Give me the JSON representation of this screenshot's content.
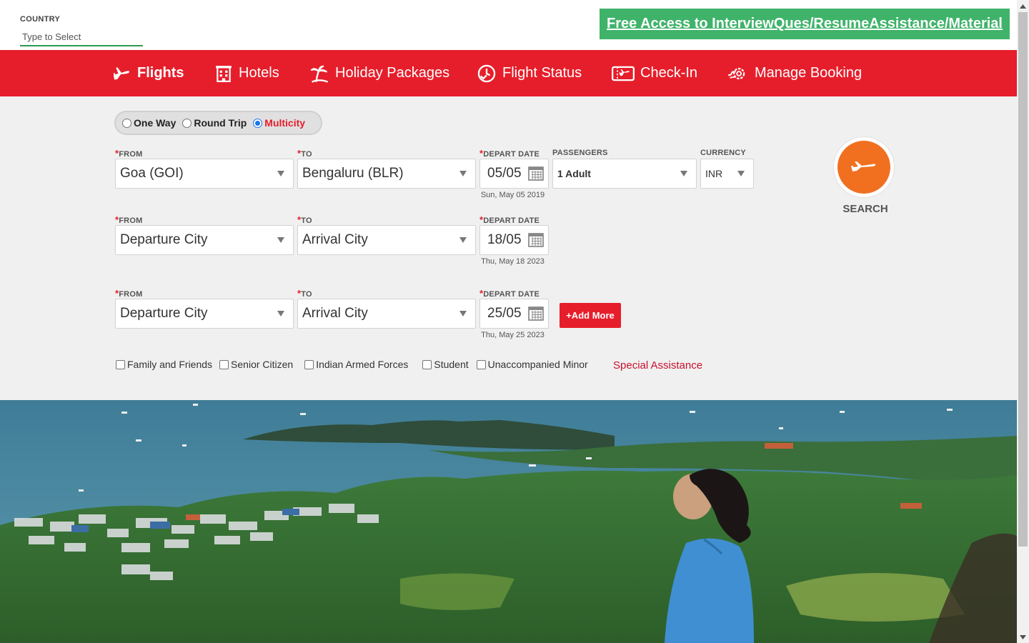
{
  "top": {
    "country_label": "COUNTRY",
    "country_placeholder": "Type to Select",
    "promo_link": "Free Access to InterviewQues/ResumeAssistance/Material"
  },
  "nav": {
    "items": [
      {
        "label": "Flights",
        "icon": "plane-icon",
        "active": true
      },
      {
        "label": "Hotels",
        "icon": "hotel-building-icon",
        "active": false
      },
      {
        "label": "Holiday Packages",
        "icon": "palm-tree-icon",
        "active": false
      },
      {
        "label": "Flight Status",
        "icon": "clock-check-icon",
        "active": false
      },
      {
        "label": "Check-In",
        "icon": "ticket-plane-icon",
        "active": false
      },
      {
        "label": "Manage Booking",
        "icon": "gear-plane-icon",
        "active": false
      }
    ]
  },
  "trip_type": {
    "options": [
      "One Way",
      "Round Trip",
      "Multicity"
    ],
    "selected": "Multicity"
  },
  "labels": {
    "from": "FROM",
    "to": "TO",
    "depart_date": "DEPART DATE",
    "passengers": "PASSENGERS",
    "currency": "CURRENCY",
    "required_mark": "*"
  },
  "legs": [
    {
      "from": "Goa (GOI)",
      "to": "Bengaluru (BLR)",
      "date": "05/05",
      "date_full": "Sun, May 05 2019"
    },
    {
      "from": "Departure City",
      "to": "Arrival City",
      "date": "18/05",
      "date_full": "Thu, May 18 2023"
    },
    {
      "from": "Departure City",
      "to": "Arrival City",
      "date": "25/05",
      "date_full": "Thu, May 25 2023"
    }
  ],
  "passengers": "1 Adult",
  "currency": "INR",
  "add_more": "+Add More",
  "search": "SEARCH",
  "special_fares": [
    "Family and Friends",
    "Senior Citizen",
    "Indian Armed Forces",
    "Student",
    "Unaccompanied Minor"
  ],
  "special_assistance": "Special Assistance",
  "colors": {
    "brand_red": "#e61e2b",
    "promo_green": "#40b36b",
    "search_orange": "#f07020"
  }
}
